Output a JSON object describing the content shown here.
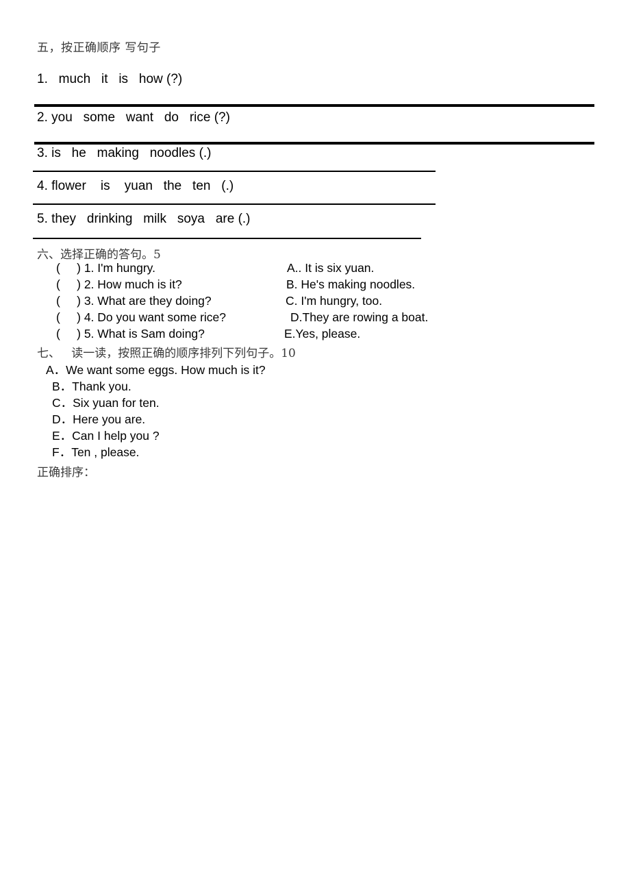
{
  "section5": {
    "heading": "五，按正确顺序 写句子",
    "questions": [
      "1.   much   it   is   how (?)",
      "2. you   some   want   do   rice (?)",
      "3. is   he   making   noodles (.)",
      "4. flower    is    yuan   the   ten   (.)",
      "5. they   drinking   milk   soya   are (.)"
    ]
  },
  "section6": {
    "heading": "六、选择正确的答句。5",
    "left_items": [
      "(     ) 1. I'm hungry.",
      "(     ) 2. How much is it?",
      "(     ) 3. What are they doing?",
      "(     ) 4. Do you want some rice?",
      "(     ) 5. What is Sam doing?"
    ],
    "right_items": [
      "A.. It is six yuan.",
      "B. He's making noodles.",
      "C. I'm hungry, too.",
      "D.They are rowing a boat.",
      "E.Yes, please."
    ],
    "right_offsets": [
      419,
      418,
      417,
      424,
      415
    ]
  },
  "section7": {
    "heading": "七、   读一读，按照正确的顺序排列下列句子。10",
    "items": [
      "A．We want some eggs. How much is it?",
      "B．Thank you.",
      "C．Six yuan for ten.",
      "D．Here you are.",
      "E．Can I help you ?",
      "F．Ten , please."
    ],
    "item_offsets": [
      67,
      76,
      76,
      76,
      76,
      76
    ],
    "answer_label": "正确排序："
  }
}
